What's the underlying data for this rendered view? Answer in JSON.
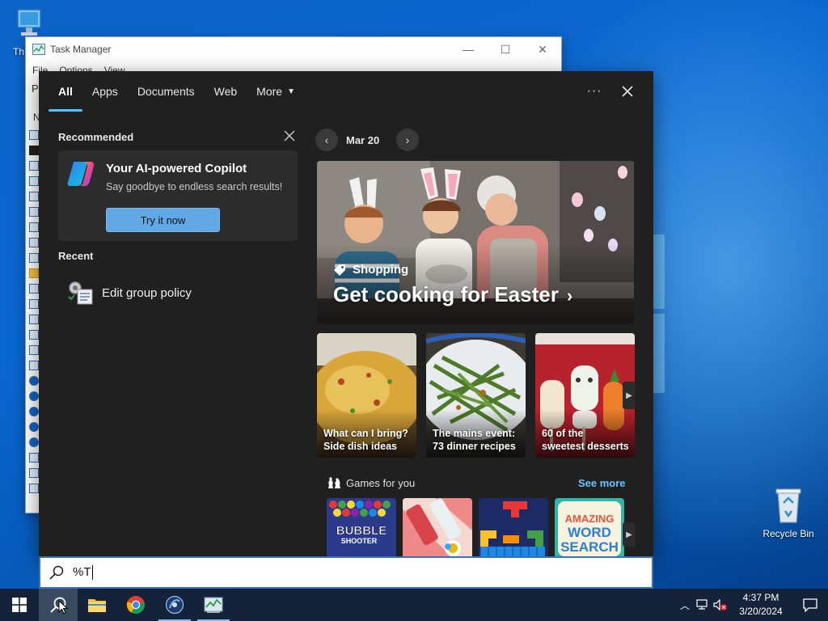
{
  "desktop": {
    "icons": [
      {
        "name": "this-pc",
        "label": "Th"
      },
      {
        "name": "recycle-bin",
        "label": "Recycle Bin"
      }
    ]
  },
  "task_manager": {
    "title": "Task Manager",
    "menu": [
      "File",
      "Options",
      "View"
    ],
    "partial_letters": [
      "P",
      "N"
    ]
  },
  "search": {
    "tabs": [
      {
        "label": "All",
        "active": true
      },
      {
        "label": "Apps",
        "active": false
      },
      {
        "label": "Documents",
        "active": false
      },
      {
        "label": "Web",
        "active": false
      },
      {
        "label": "More",
        "active": false
      }
    ],
    "recommended": {
      "title": "Recommended",
      "card_title": "Your AI-powered Copilot",
      "card_subtitle": "Say goodbye to endless search results!",
      "button_label": "Try it now"
    },
    "recent": {
      "title": "Recent",
      "items": [
        {
          "label": "Edit group policy",
          "icon": "group-policy-icon"
        }
      ]
    },
    "highlights": {
      "date": "Mar 20",
      "hero": {
        "kicker": "Shopping",
        "title": "Get cooking for Easter",
        "chevron": "›"
      },
      "cards": [
        {
          "line1": "What can I bring?",
          "line2": "Side dish ideas"
        },
        {
          "line1": "The mains event:",
          "line2": "73 dinner recipes"
        },
        {
          "line1": "60 of the",
          "line2": "sweetest desserts"
        }
      ],
      "games_title": "Games for you",
      "see_more": "See more",
      "games": [
        {
          "name": "bubble-shooter",
          "label1": "BUBBLE",
          "label2": "SHOOTER"
        },
        {
          "name": "darts-game"
        },
        {
          "name": "block-puzzle"
        },
        {
          "name": "amazing-word-search",
          "label1": "AMAZING",
          "label2": "WORD",
          "label3": "SEARCH"
        }
      ]
    },
    "query": "%T"
  },
  "taskbar": {
    "time": "4:37 PM",
    "date": "3/20/2024"
  },
  "colors": {
    "accent": "#4cc2ff",
    "flyout_bg": "#202020",
    "button_blue": "#60a9e6",
    "link_blue": "#6cc4ff",
    "taskbar_bg": "#14233a"
  }
}
